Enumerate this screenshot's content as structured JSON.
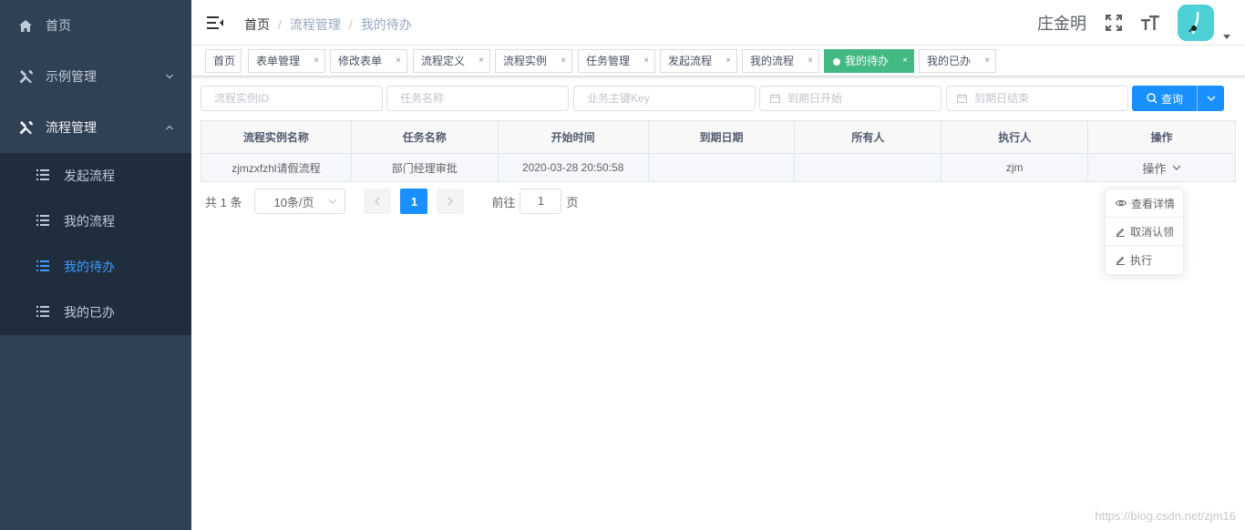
{
  "sidebar": {
    "items": [
      {
        "label": "首页",
        "icon": "home-icon"
      },
      {
        "label": "示例管理",
        "icon": "tools-icon"
      },
      {
        "label": "流程管理",
        "icon": "tools-icon"
      }
    ],
    "subitems": [
      {
        "label": "发起流程",
        "icon": "list-icon"
      },
      {
        "label": "我的流程",
        "icon": "list-icon"
      },
      {
        "label": "我的待办",
        "icon": "list-icon",
        "active": true
      },
      {
        "label": "我的已办",
        "icon": "list-icon"
      }
    ],
    "colors": {
      "background": "#304156",
      "submenu": "#1f2d3d",
      "active": "#409eff"
    }
  },
  "navbar": {
    "breadcrumb": [
      "首页",
      "流程管理",
      "我的待办"
    ],
    "separator": "/",
    "user_name": "庄金明",
    "icons": [
      "fullscreen-icon",
      "font-size-icon"
    ]
  },
  "tags": [
    {
      "label": "首页"
    },
    {
      "label": "表单管理",
      "close": "×"
    },
    {
      "label": "修改表单",
      "close": "×"
    },
    {
      "label": "流程定义",
      "close": "×"
    },
    {
      "label": "流程实例",
      "close": "×"
    },
    {
      "label": "任务管理",
      "close": "×"
    },
    {
      "label": "发起流程",
      "close": "×"
    },
    {
      "label": "我的流程",
      "close": "×"
    },
    {
      "label": "我的待办",
      "close": "×",
      "active": true
    },
    {
      "label": "我的已办",
      "close": "×"
    }
  ],
  "tag_active_color": "#42b983",
  "search": {
    "instance_id_placeholder": "流程实例ID",
    "task_name_placeholder": "任务名称",
    "business_key_placeholder": "业务主键Key",
    "due_start_placeholder": "到期日开始",
    "due_end_placeholder": "到期日结束",
    "query_label": "查询",
    "primary_color": "#1890ff"
  },
  "table": {
    "headers": [
      "流程实例名称",
      "任务名称",
      "开始时间",
      "到期日期",
      "所有人",
      "执行人",
      "操作"
    ],
    "rows": [
      [
        "zjmzxfzhl请假流程",
        "部门经理审批",
        "2020-03-28 20:50:58",
        "",
        "",
        "zjm",
        "操作"
      ]
    ]
  },
  "pagination": {
    "total": "共 1 条",
    "page_size": "10条/页",
    "current_page": "1",
    "goto_prefix": "前往",
    "goto_value": "1",
    "goto_suffix": "页"
  },
  "dropdown": {
    "items": [
      {
        "label": "查看详情",
        "icon": "eye-icon"
      },
      {
        "label": "取消认领",
        "icon": "edit-icon"
      },
      {
        "label": "执行",
        "icon": "edit-icon"
      }
    ]
  },
  "watermark": "https://blog.csdn.net/zjm16"
}
